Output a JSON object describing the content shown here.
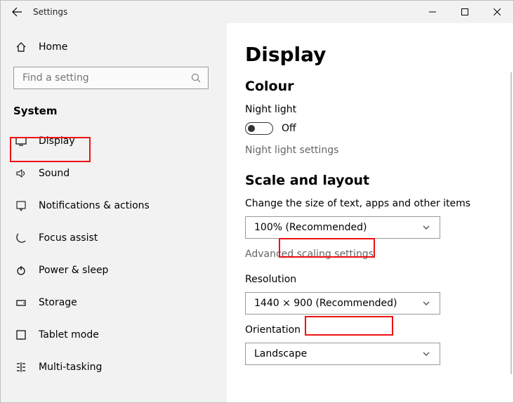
{
  "titlebar": {
    "title": "Settings"
  },
  "sidebar": {
    "home": "Home",
    "search_placeholder": "Find a setting",
    "section": "System",
    "items": [
      {
        "label": "Display"
      },
      {
        "label": "Sound"
      },
      {
        "label": "Notifications & actions"
      },
      {
        "label": "Focus assist"
      },
      {
        "label": "Power & sleep"
      },
      {
        "label": "Storage"
      },
      {
        "label": "Tablet mode"
      },
      {
        "label": "Multi-tasking"
      }
    ]
  },
  "main": {
    "page_title": "Display",
    "colour_heading": "Colour",
    "night_light_label": "Night light",
    "night_light_state": "Off",
    "night_light_settings": "Night light settings",
    "scale_heading": "Scale and layout",
    "scale_label": "Change the size of text, apps and other items",
    "scale_value": "100% (Recommended)",
    "advanced_scaling": "Advanced scaling settings",
    "resolution_label": "Resolution",
    "resolution_value": "1440 × 900 (Recommended)",
    "orientation_label": "Orientation",
    "orientation_value": "Landscape"
  }
}
